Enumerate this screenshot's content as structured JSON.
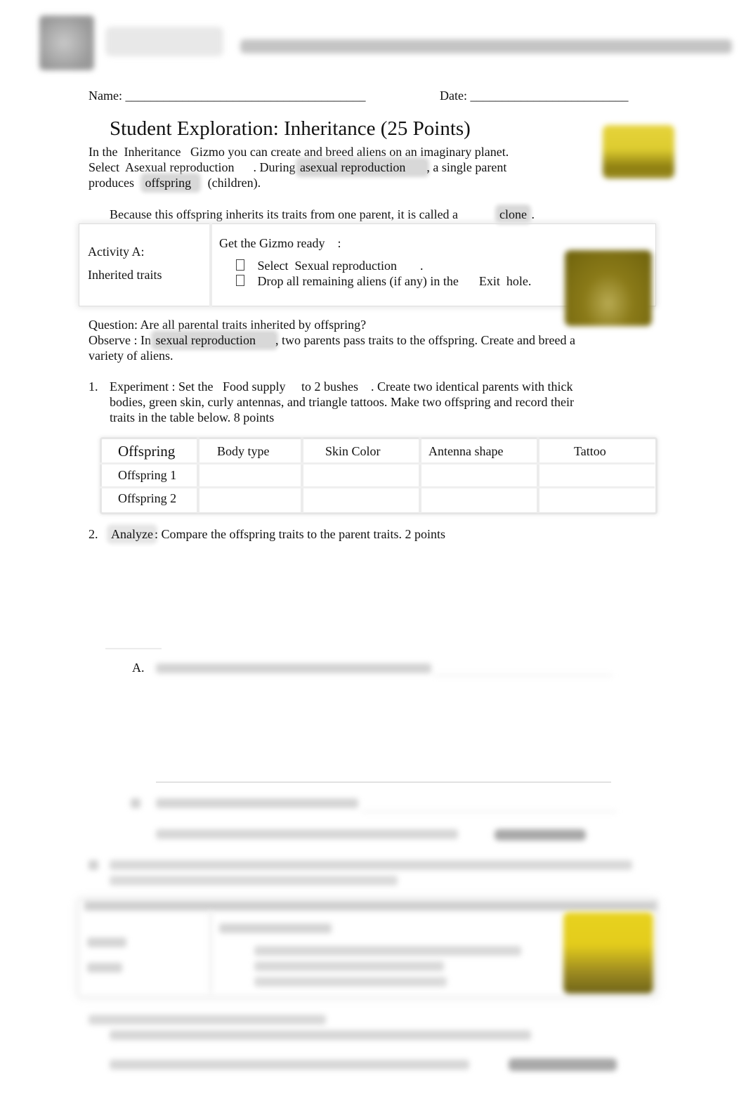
{
  "header": {
    "logo_icon": "gizmos-logo-icon",
    "brand": "Gizmos"
  },
  "form": {
    "name_label": "Name:",
    "name_blank": "______________________________________",
    "date_label": "Date:",
    "date_blank": "_________________________"
  },
  "title": "Student Exploration: Inheritance (25 Points)",
  "intro": {
    "line1_a": "In the",
    "line1_gizmo": "Inheritance",
    "line1_b": "Gizmo you can create and breed aliens on an imaginary planet.",
    "line2_a": "Select",
    "line2_option": "Asexual reproduction",
    "line2_b": ". During",
    "line2_term": "asexual reproduction",
    "line2_c": ", a single parent",
    "line3_a": "produces",
    "line3_term": "offspring",
    "line3_b": "(children).",
    "line4_a": "Because this offspring inherits its traits from one parent, it is called a",
    "line4_term": "clone",
    "line4_b": "."
  },
  "activity_a": {
    "label": "Activity A:",
    "name": "Inherited traits",
    "ready_heading": "Get the Gizmo ready",
    "ready_colon": ":",
    "steps": [
      {
        "a": "Select",
        "b": "Sexual reproduction",
        "c": "."
      },
      {
        "a": "Drop all remaining aliens (if any) in the",
        "b": "Exit",
        "c": "hole."
      }
    ]
  },
  "question": "Question: Are all parental traits inherited by offspring?",
  "observe": {
    "label": "Observe",
    "text_a": ": In",
    "term": "sexual reproduction",
    "text_b": ", two parents pass traits to the offspring. Create and breed a",
    "text_c": "variety of aliens."
  },
  "q1": {
    "num": "1.",
    "label": "Experiment",
    "a": ": Set the",
    "food": "Food supply",
    "b": "to",
    "bushes": "2 bushes",
    "c": ". Create two identical parents with thick",
    "line2": "bodies, green skin, curly antennas, and triangle tattoos. Make two offspring and record their",
    "line3": "traits in the table below. 8 points"
  },
  "table": {
    "headers": [
      "Offspring",
      "Body type",
      "Skin Color",
      "Antenna shape",
      "Tattoo"
    ],
    "rows": [
      [
        "Offspring 1",
        "",
        "",
        "",
        ""
      ],
      [
        "Offspring 2",
        "",
        "",
        "",
        ""
      ]
    ]
  },
  "q2": {
    "num": "2.",
    "label": "Analyze",
    "text": ": Compare the offspring traits to the parent traits. 2 points",
    "sub_a_label": "A."
  }
}
